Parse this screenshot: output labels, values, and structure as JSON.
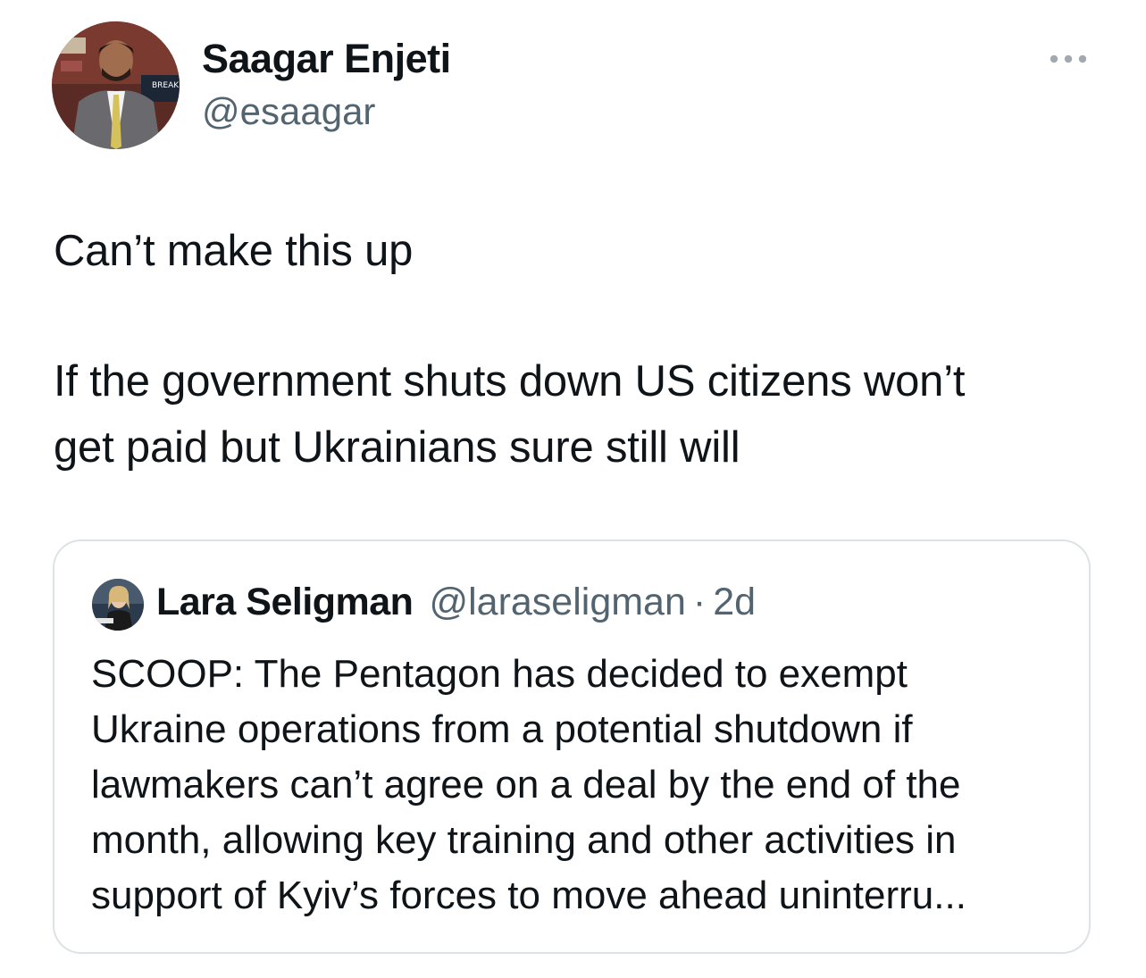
{
  "tweet": {
    "author": {
      "display_name": "Saagar Enjeti",
      "handle": "@esaagar",
      "avatar_icon": "profile-photo"
    },
    "more_icon": "more-horizontal-icon",
    "text_lines": [
      "Can’t make this up",
      "If the government shuts down US citizens won’t",
      "get paid but Ukrainians sure still will"
    ]
  },
  "quote": {
    "author": {
      "display_name": "Lara Seligman",
      "handle": "@laraseligman",
      "separator": "·",
      "time": "2d",
      "avatar_icon": "profile-photo"
    },
    "text_lines": [
      "SCOOP: The Pentagon has decided to exempt",
      "Ukraine operations from a potential shutdown if",
      "lawmakers can’t agree on a deal by the end of the",
      "month, allowing key training and other activities in",
      "support of Kyiv’s forces to move ahead uninterru..."
    ]
  },
  "colors": {
    "text_primary": "#0f1419",
    "text_secondary": "#536471",
    "border": "#dde2e6"
  }
}
